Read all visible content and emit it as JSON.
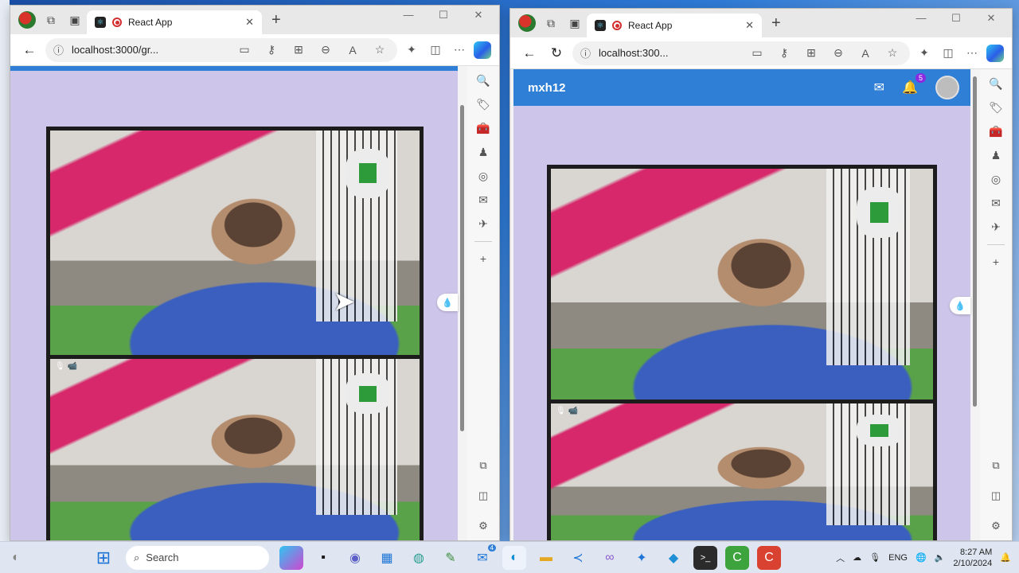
{
  "left_window": {
    "tab_title": "React App",
    "url": "localhost:3000/gr...",
    "window_controls": [
      "—",
      "☐",
      "✕"
    ]
  },
  "right_window": {
    "tab_title": "React App",
    "url": "localhost:300...",
    "window_controls": [
      "—",
      "☐",
      "✕"
    ],
    "app_header": {
      "brand": "mxh12",
      "notification_count": "5"
    }
  },
  "icons": {
    "back": "←",
    "reload": "↻",
    "info": "ⓘ",
    "camera": "▭",
    "key": "⚷",
    "apps": "⊞",
    "zoom": "⊖",
    "read_aloud": "A",
    "favorite": "☆",
    "extensions": "✦",
    "split": "◫",
    "more": "⋯",
    "new_tab": "+",
    "tab_close": "✕",
    "mail": "✉",
    "bell": "🔔",
    "mic_cam": "🎙 📹"
  },
  "sidebar_icons": [
    "🔍",
    "🏷",
    "🧰",
    "♟",
    "◎",
    "✉",
    "✈",
    "+"
  ],
  "sidebar_bottom_icons": [
    "⧉",
    "◫",
    "⚙"
  ],
  "taskbar": {
    "search_placeholder": "Search",
    "mail_badge": "4",
    "language": "ENG",
    "time": "8:27 AM",
    "date": "2/10/2024"
  }
}
